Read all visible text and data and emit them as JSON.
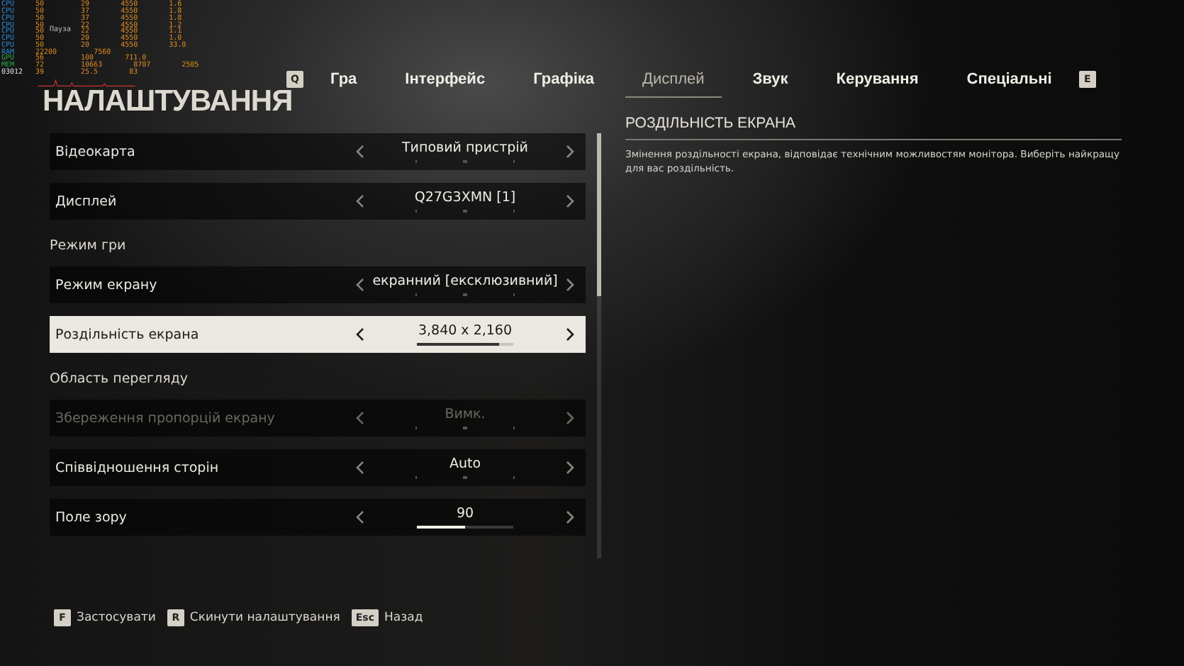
{
  "overlay": {
    "rows": [
      {
        "label": "CPU",
        "values": [
          "50",
          "29",
          "4550",
          "1.6"
        ],
        "kind": "cpu"
      },
      {
        "label": "CPU",
        "values": [
          "50",
          "37",
          "4550",
          "1.8"
        ],
        "kind": "cpu"
      },
      {
        "label": "CPU",
        "values": [
          "50",
          "37",
          "4550",
          "1.8"
        ],
        "kind": "cpu"
      },
      {
        "label": "CPU",
        "values": [
          "50",
          "22",
          "4550",
          "1.2"
        ],
        "kind": "cpu"
      },
      {
        "label": "CPU",
        "values": [
          "50",
          "22",
          "4550",
          "1.1"
        ],
        "kind": "cpu"
      },
      {
        "label": "CPU",
        "values": [
          "50",
          "20",
          "4550",
          "1.0"
        ],
        "kind": "cpu"
      },
      {
        "label": "CPU",
        "values": [
          "50",
          "20",
          "4550",
          "33.0"
        ],
        "kind": "cpu"
      },
      {
        "label": "RAM",
        "values": [
          "22200",
          "7560"
        ],
        "kind": "mem"
      },
      {
        "label": "GPU",
        "values": [
          "56",
          "100",
          "711.0"
        ],
        "kind": "gpu"
      },
      {
        "label": "MEM",
        "values": [
          "72",
          "10663",
          "8707",
          "2505"
        ],
        "kind": "gpu"
      },
      {
        "label": "03012",
        "values": [
          "39",
          "25.5",
          "83"
        ],
        "kind": "fps"
      }
    ],
    "pause_label": "Пауза"
  },
  "title": "НАЛАШТУВАННЯ",
  "tabs": {
    "prev_key": "Q",
    "next_key": "E",
    "items": [
      {
        "label": "Гра",
        "selected": false
      },
      {
        "label": "Інтерфейс",
        "selected": false
      },
      {
        "label": "Графіка",
        "selected": false
      },
      {
        "label": "Дисплей",
        "selected": true
      },
      {
        "label": "Звук",
        "selected": false
      },
      {
        "label": "Керування",
        "selected": false
      },
      {
        "label": "Спеціальні",
        "selected": false
      }
    ]
  },
  "settings": [
    {
      "kind": "option",
      "label": "Відеокарта",
      "value": "Типовий пристрій",
      "selected": false,
      "disabled": false
    },
    {
      "kind": "option",
      "label": "Дисплей",
      "value": "Q27G3XMN [1]",
      "selected": false,
      "disabled": false
    },
    {
      "kind": "section",
      "label": "Режим гри"
    },
    {
      "kind": "option",
      "label": "Режим екрану",
      "value": "екранний [ексклюзивний]",
      "selected": false,
      "disabled": false
    },
    {
      "kind": "option",
      "label": "Роздільність екрана",
      "value": "3,840 x 2,160",
      "selected": true,
      "disabled": false,
      "level": 0.85
    },
    {
      "kind": "section",
      "label": "Область перегляду"
    },
    {
      "kind": "option",
      "label": "Збереження пропорцій екрану",
      "value": "Вимк.",
      "selected": false,
      "disabled": true
    },
    {
      "kind": "option",
      "label": "Співвідношення сторін",
      "value": "Auto",
      "selected": false,
      "disabled": false
    },
    {
      "kind": "option",
      "label": "Поле зору",
      "value": "90",
      "selected": false,
      "disabled": false,
      "level": 0.5
    }
  ],
  "description": {
    "title": "РОЗДІЛЬНІСТЬ ЕКРАНА",
    "text": "Змінення роздільності екрана, відповідає технічним можливостям монітора. Виберіть найкращу для вас роздільність."
  },
  "footer": [
    {
      "key": "F",
      "label": "Застосувати"
    },
    {
      "key": "R",
      "label": "Скинути налаштування"
    },
    {
      "key": "Esc",
      "label": "Назад"
    }
  ]
}
